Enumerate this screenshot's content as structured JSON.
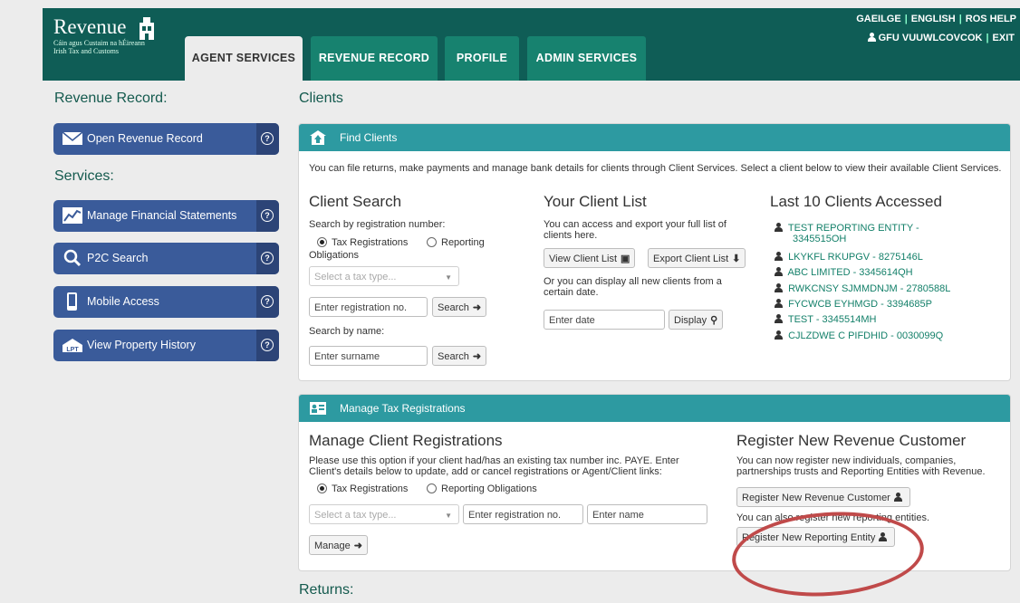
{
  "brand": {
    "name": "Revenue",
    "sub1": "Cáin agus Custaim na hÉireann",
    "sub2": "Irish Tax and Customs"
  },
  "tabs": [
    "AGENT SERVICES",
    "REVENUE RECORD",
    "PROFILE",
    "ADMIN SERVICES"
  ],
  "toplinks": [
    "GAEILGE",
    "ENGLISH",
    "ROS HELP"
  ],
  "user": {
    "name": "GFU VUUWLCOVCOK",
    "exit": "EXIT"
  },
  "sidebar": {
    "heading1": "Revenue Record:",
    "open_record": "Open Revenue Record",
    "heading2": "Services:",
    "items": [
      "Manage Financial Statements",
      "P2C Search",
      "Mobile Access",
      "View Property History"
    ],
    "help": "?"
  },
  "main": {
    "title": "Clients",
    "returns": "Returns:",
    "find": {
      "header": "Find Clients",
      "intro": "You can file returns, make payments and manage bank details for clients through Client Services. Select a client below to view their available Client Services.",
      "client_search": {
        "title": "Client Search",
        "by_reg": "Search by registration number:",
        "radio1": "Tax Registrations",
        "radio2": "Reporting",
        "radio2_cont": "Obligations",
        "tax_type_placeholder": "Select a tax type...",
        "reg_placeholder": "Enter registration no.",
        "search": "Search",
        "by_name": "Search by name:",
        "surname_placeholder": "Enter surname"
      },
      "client_list": {
        "title": "Your Client List",
        "text1a": "You can access and export your full list of",
        "text1b": "clients here.",
        "view": "View Client List",
        "export": "Export Client List",
        "text2a": "Or you can display all new clients from a",
        "text2b": "certain date.",
        "date_placeholder": "Enter date",
        "display": "Display"
      },
      "last10": {
        "title": "Last 10 Clients Accessed",
        "clients": [
          "TEST REPORTING ENTITY -",
          "3345515OH",
          "LKYKFL RKUPGV - 8275146L",
          "ABC LIMITED - 3345614QH",
          "RWKCNSY SJMMDNJM - 2780588L",
          "FYCWCB EYHMGD - 3394685P",
          "TEST - 3345514MH",
          "CJLZDWE C PIFDHID - 0030099Q"
        ]
      }
    },
    "manage": {
      "header": "Manage Tax Registrations",
      "title": "Manage Client Registrations",
      "text1": "Please use this option if your client had/has an existing tax number inc. PAYE. Enter",
      "text2": "Client's details below to update, add or cancel registrations or Agent/Client links:",
      "radio1": "Tax Registrations",
      "radio2": "Reporting Obligations",
      "tax_type_placeholder": "Select a tax type...",
      "reg_placeholder": "Enter registration no.",
      "name_placeholder": "Enter name",
      "manage": "Manage",
      "register_title": "Register New Revenue Customer",
      "register_text1": "You can now register new individuals, companies,",
      "register_text2": "partnerships trusts and Reporting Entities with Revenue.",
      "register_customer": "Register New Revenue Customer",
      "register_also": "You can also register new reporting entities.",
      "register_entity": "Register New Reporting Entity"
    }
  },
  "colors": {
    "header": "#0f5d56",
    "tab": "#17826f",
    "panel_header": "#2d9aa1",
    "sidebar_button": "#3a5b9a",
    "link": "#14806a",
    "highlight": "#c04a4a"
  }
}
